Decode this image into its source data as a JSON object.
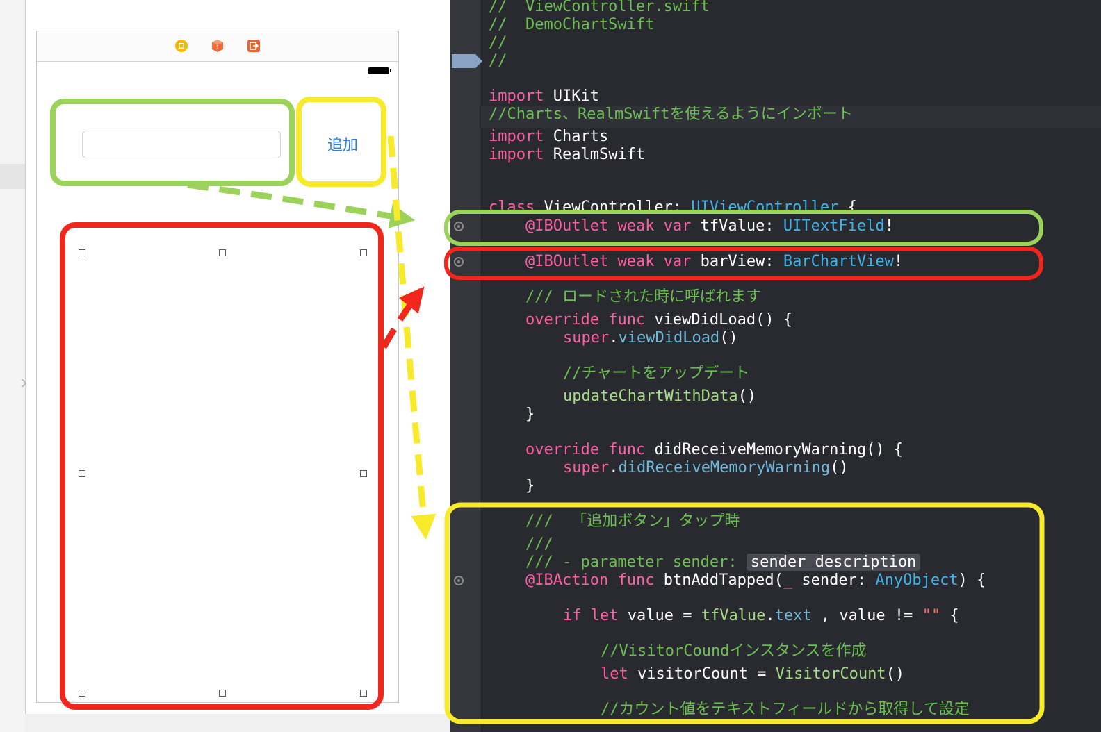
{
  "storyboard": {
    "add_button_label": "追加",
    "dock_icons": [
      "view-controller-icon",
      "first-responder-icon",
      "exit-icon"
    ]
  },
  "code": {
    "line_filename": "//  ViewController.swift",
    "line_project": "//  DemoChartSwift",
    "line_empty1": "//",
    "line_empty2": "//",
    "import_kw1": "import",
    "import_uikit": " UIKit",
    "comment_import": "//Charts、RealmSwiftを使えるようにインポート",
    "import_kw2": "import",
    "import_charts": " Charts",
    "import_kw3": "import",
    "import_realm": " RealmSwift",
    "class_kw": "class",
    "class_name": " ViewController: ",
    "class_super": "UIViewController",
    "class_brace": " {",
    "outlet1_attr": "@IBOutlet",
    "outlet1_mods": " weak var ",
    "outlet1_name": "tfValue: ",
    "outlet1_type": "UITextField",
    "outlet1_bang": "!",
    "outlet2_attr": "@IBOutlet",
    "outlet2_mods": " weak var ",
    "outlet2_name": "barView: ",
    "outlet2_type": "BarChartView",
    "outlet2_bang": "!",
    "doc_load": "/// ロードされた時に呼ばれます",
    "override_kw1": "override func ",
    "viewdidload_sig": "viewDidLoad() {",
    "super_kw1": "super",
    "super_dot1": ".",
    "super_call1": "viewDidLoad",
    "super_paren1": "()",
    "comment_update": "//チャートをアップデート",
    "update_call": "updateChartWithData",
    "update_paren": "()",
    "close_brace1": "}",
    "override_kw2": "override func ",
    "memory_sig": "didReceiveMemoryWarning() {",
    "super_kw2": "super",
    "super_dot2": ".",
    "super_call2": "didReceiveMemoryWarning",
    "super_paren2": "()",
    "close_brace2": "}",
    "doc_tap": "///  「追加ボタン」タップ時",
    "doc_blank": "///",
    "doc_param": "/// - parameter sender: ",
    "doc_param_placeholder": "sender description",
    "action_attr": "@IBAction",
    "action_func": " func ",
    "action_name": "btnAddTapped(",
    "action_underscore": "_",
    "action_param": " sender: ",
    "action_type": "AnyObject",
    "action_close": ") {",
    "if_kw": "if let",
    "if_value": " value = ",
    "if_tf": "tfValue",
    "if_dot": ".",
    "if_text": "text",
    "if_cond": " , value != ",
    "if_str": "\"\"",
    "if_brace": " {",
    "comment_instance": "//VisitorCoundインスタンスを作成",
    "let_kw": "let",
    "let_var": " visitorCount = ",
    "let_type": "VisitorCount",
    "let_paren": "()",
    "comment_count": "//カウント値をテキストフィールドから取得して設定"
  },
  "annotation_colors": {
    "green": "#9ad25a",
    "yellow": "#f7ea2b",
    "red": "#f2271b"
  }
}
